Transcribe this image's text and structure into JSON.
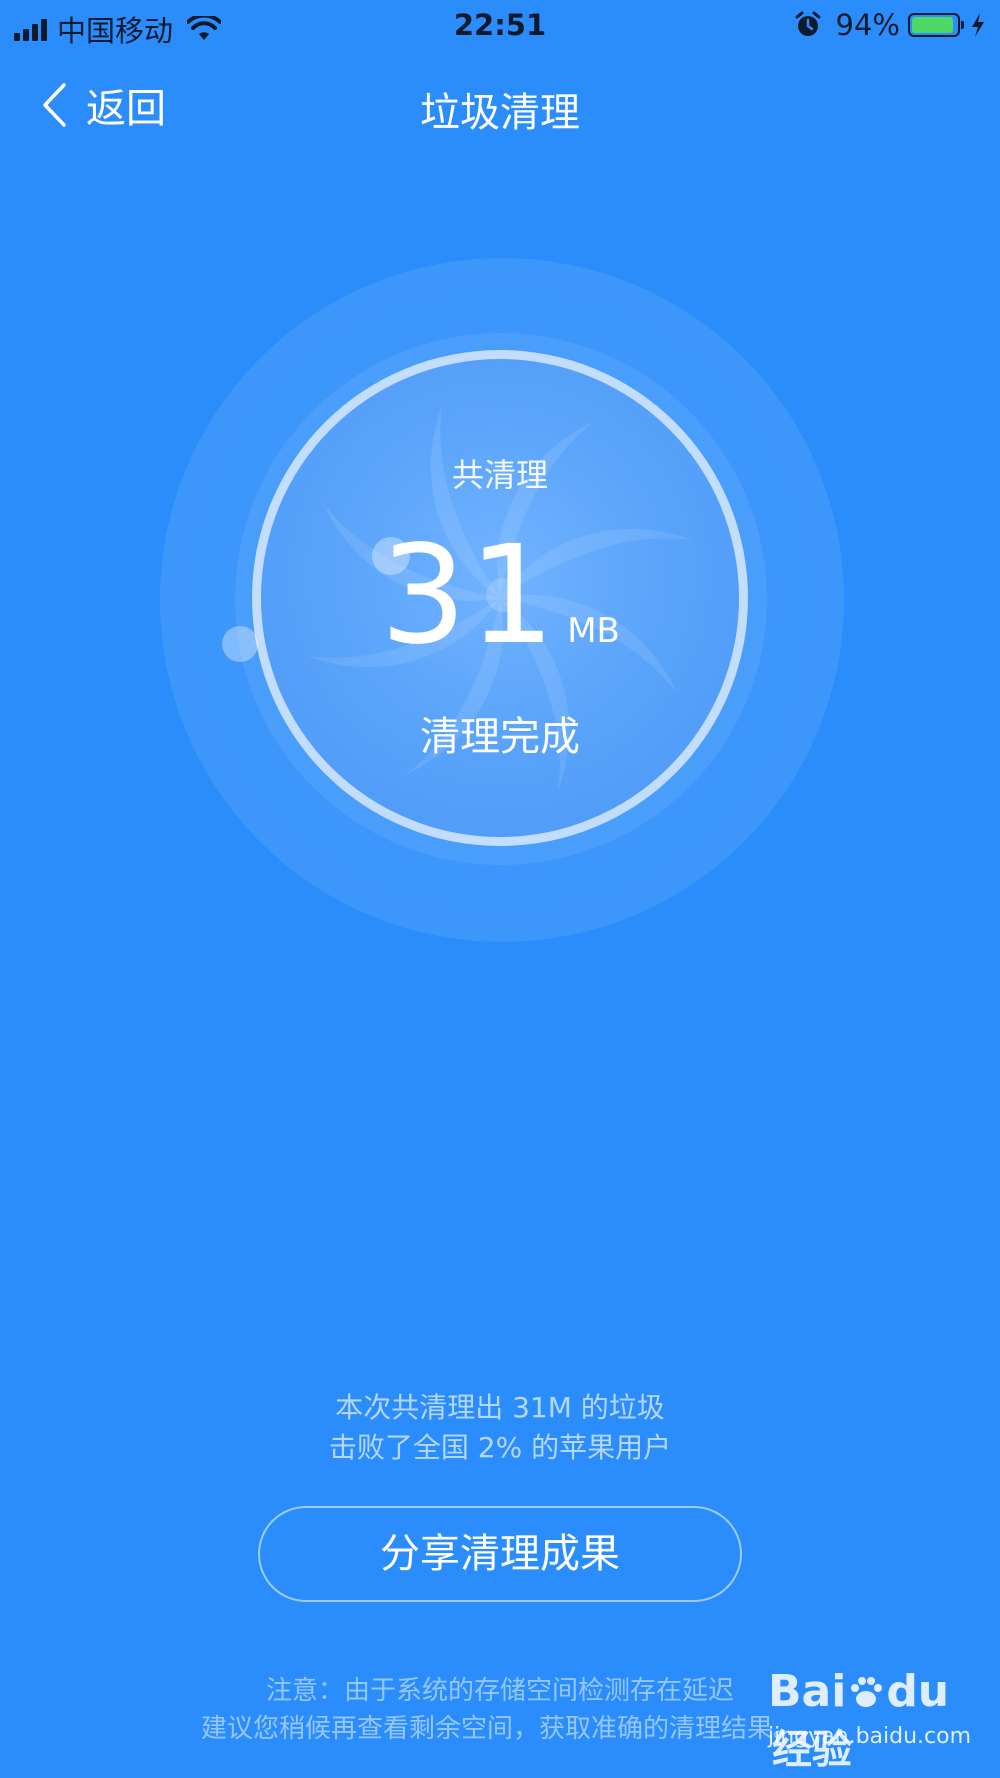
{
  "status_bar": {
    "carrier": "中国移动",
    "time": "22:51",
    "battery_percent": "94%",
    "battery_level": 0.94,
    "icons": [
      "signal-icon",
      "wifi-icon",
      "alarm-icon",
      "battery-icon",
      "charging-bolt-icon"
    ]
  },
  "nav": {
    "back_label": "返回",
    "title": "垃圾清理"
  },
  "result": {
    "label_top": "共清理",
    "size_value": "31",
    "size_unit": "MB",
    "status": "清理完成"
  },
  "summary": {
    "line1": "本次共清理出 31M 的垃圾",
    "line2": "击败了全国 2% 的苹果用户"
  },
  "share_button_label": "分享清理成果",
  "notice": {
    "line1": "注意：由于系统的存储空间检测存在延迟",
    "line2": "建议您稍候再查看剩余空间，获取准确的清理结果。"
  },
  "watermark": {
    "brand_left": "Bai",
    "brand_right": "du",
    "suffix": "经验",
    "url": "jingyan.baidu.com"
  },
  "colors": {
    "background": "#2a8dfb",
    "battery_green": "#4cd964"
  }
}
